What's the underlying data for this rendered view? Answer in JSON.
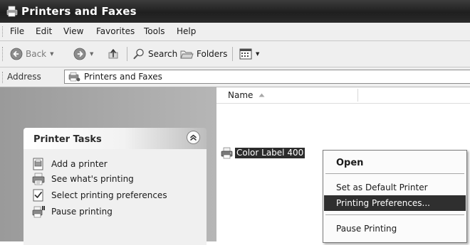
{
  "window": {
    "title": "Printers and Faxes"
  },
  "menubar": {
    "items": [
      "File",
      "Edit",
      "View",
      "Favorites",
      "Tools",
      "Help"
    ]
  },
  "toolbar": {
    "back_label": "Back",
    "search_label": "Search",
    "folders_label": "Folders"
  },
  "address": {
    "label": "Address",
    "value": "Printers and Faxes"
  },
  "taskpane": {
    "header": "Printer Tasks",
    "items": [
      "Add a printer",
      "See what's printing",
      "Select printing preferences",
      "Pause printing"
    ]
  },
  "filelist": {
    "column_name": "Name",
    "items": [
      {
        "name": "Color Label 400",
        "selected": true
      }
    ]
  },
  "context_menu": {
    "items": [
      "Open",
      "Set as Default Printer",
      "Printing Preferences...",
      "Pause Printing"
    ],
    "default_item": "Open",
    "highlighted_item": "Printing Preferences..."
  },
  "icons": {
    "title": "printer-icon",
    "back": "back-arrow-icon",
    "forward": "forward-arrow-icon",
    "up": "up-folder-icon",
    "search": "search-icon",
    "folders": "folders-icon",
    "views": "views-icon",
    "collapse": "collapse-chevron-icon",
    "sort": "sort-ascending-icon",
    "add_printer": "add-printer-icon",
    "see_printing": "print-queue-icon",
    "preferences": "preferences-icon",
    "pause": "pause-printer-icon"
  },
  "colors": {
    "selection": "#2c2c2c",
    "title_bar": "#2a2a2a",
    "task_pane": "#a8a8a8"
  }
}
